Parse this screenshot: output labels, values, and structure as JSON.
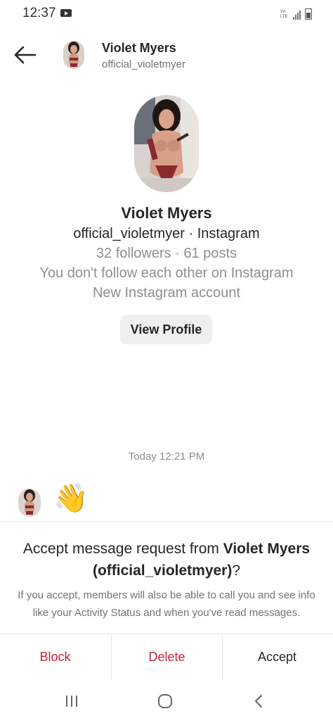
{
  "status_bar": {
    "time": "12:37",
    "volte_label": "Vo LTE"
  },
  "header": {
    "name": "Violet Myers",
    "handle": "official_violetmyer"
  },
  "profile": {
    "name": "Violet Myers",
    "subtitle": "official_violetmyer · Instagram",
    "stats": "32 followers · 61 posts",
    "follow_status": "You don't follow each other on Instagram",
    "account_note": "New Instagram account",
    "view_profile_label": "View Profile"
  },
  "conversation": {
    "timestamp": "Today 12:21 PM",
    "message_emoji": "👋"
  },
  "request": {
    "title_prefix": "Accept message request from ",
    "title_name": "Violet Myers",
    "title_handle": "(official_violetmyer)",
    "title_suffix": "?",
    "info": "If you accept, members will also be able to call you and see info like your Activity Status and when you've read messages."
  },
  "actions": {
    "block_label": "Block",
    "delete_label": "Delete",
    "accept_label": "Accept"
  },
  "colors": {
    "destructive": "#c4213a",
    "primary_text": "#262626",
    "secondary_text": "#8e8e8e"
  },
  "icons": {
    "back": "arrow-left-icon",
    "status_media": "youtube-icon",
    "nav_recents": "recents-icon",
    "nav_home": "home-icon",
    "nav_back": "chevron-left-icon"
  }
}
